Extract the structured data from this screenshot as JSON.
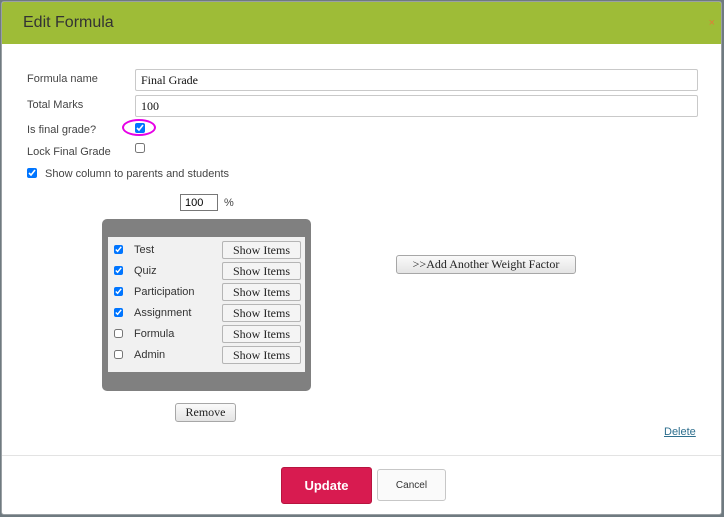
{
  "dialog": {
    "title": "Edit Formula",
    "close_glyph": "×"
  },
  "form": {
    "formula_name_label": "Formula name",
    "formula_name_value": "Final Grade",
    "total_marks_label": "Total Marks",
    "total_marks_value": "100",
    "is_final_grade_label": "Is final grade?",
    "is_final_grade_checked": true,
    "lock_final_grade_label": "Lock Final Grade",
    "lock_final_grade_checked": false,
    "show_column_label": "Show column to parents and students",
    "show_column_checked": true
  },
  "weight": {
    "percent_value": "100",
    "percent_sign": "%",
    "items": [
      {
        "label": "Test",
        "checked": true,
        "button": "Show Items"
      },
      {
        "label": "Quiz",
        "checked": true,
        "button": "Show Items"
      },
      {
        "label": "Participation",
        "checked": true,
        "button": "Show Items"
      },
      {
        "label": "Assignment",
        "checked": true,
        "button": "Show Items"
      },
      {
        "label": "Formula",
        "checked": false,
        "button": "Show Items"
      },
      {
        "label": "Admin",
        "checked": false,
        "button": "Show Items"
      }
    ],
    "remove_label": "Remove",
    "add_factor_label": ">>Add Another Weight Factor"
  },
  "actions": {
    "delete_label": "Delete",
    "update_label": "Update",
    "cancel_label": "Cancel"
  },
  "colors": {
    "header": "#9ebc37",
    "update_button": "#d81b50",
    "highlight_circle": "#e600e6"
  }
}
